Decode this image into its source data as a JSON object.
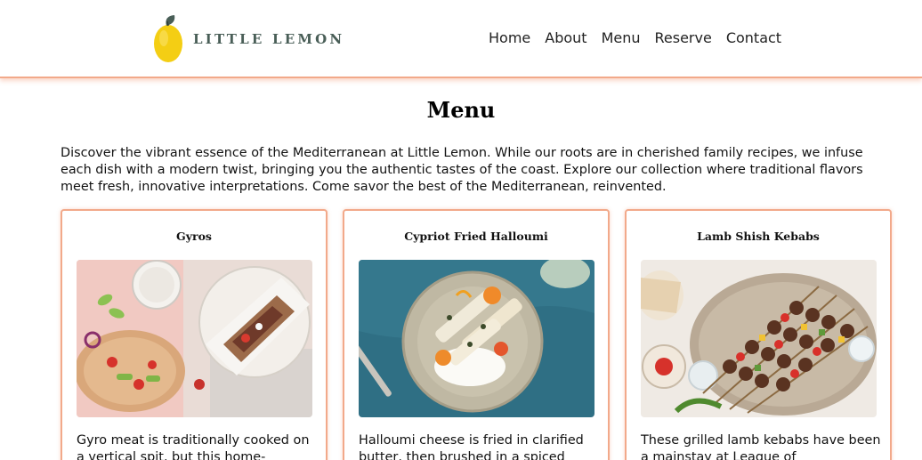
{
  "brand": {
    "name": "LITTLE LEMON",
    "logo_icon": "lemon-icon",
    "colors": {
      "logo_text": "#495e57",
      "lemon": "#f4ce14",
      "accent_border": "#f2a98a"
    }
  },
  "nav": {
    "items": [
      {
        "label": "Home"
      },
      {
        "label": "About"
      },
      {
        "label": "Menu"
      },
      {
        "label": "Reserve"
      },
      {
        "label": "Contact"
      }
    ]
  },
  "main": {
    "title": "Menu",
    "intro": "Discover the vibrant essence of the Mediterranean at Little Lemon. While our roots are in cherished family recipes, we infuse each dish with a modern twist, bringing you the authentic tastes of the coast. Explore our collection where traditional flavors meet fresh, innovative interpretations. Come savor the best of the Mediterranean, reinvented.",
    "cards": [
      {
        "title": "Gyros",
        "image": "gyros-photo",
        "description": "Gyro meat is traditionally cooked on a vertical spit, but this home-"
      },
      {
        "title": "Cypriot Fried Halloumi",
        "image": "halloumi-photo",
        "description": "Halloumi cheese is fried in clarified butter, then brushed in a spiced"
      },
      {
        "title": "Lamb Shish Kebabs",
        "image": "kebabs-photo",
        "description": "These grilled lamb kebabs have been a mainstay at League of"
      }
    ]
  }
}
